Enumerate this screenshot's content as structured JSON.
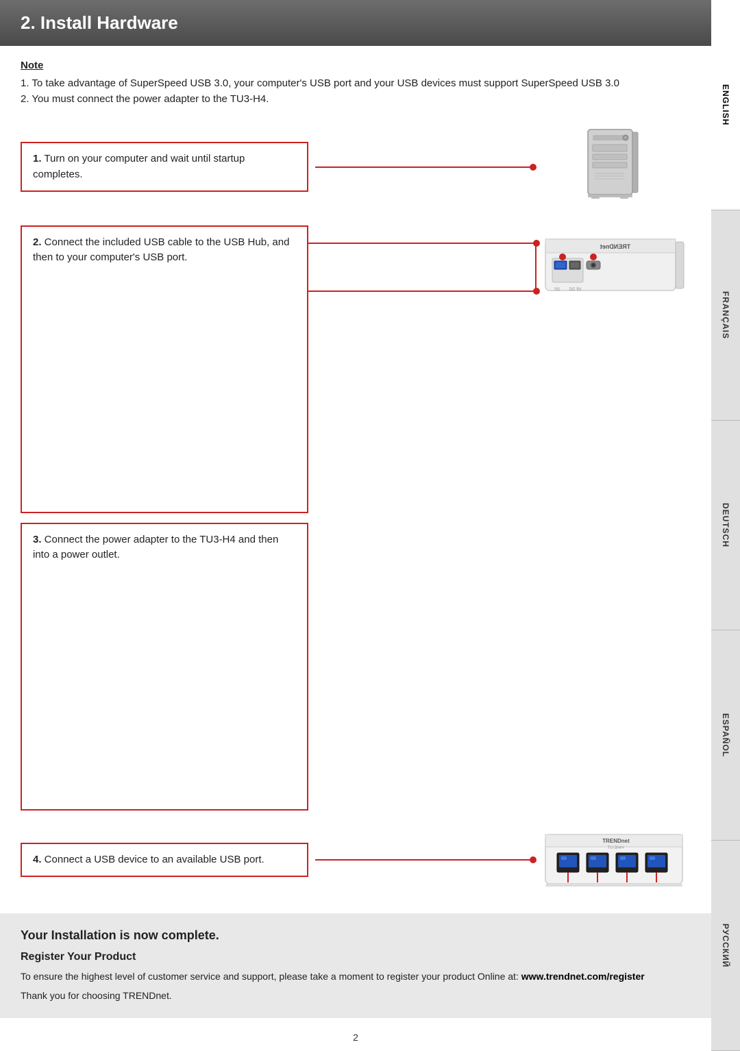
{
  "header": {
    "title": "2. Install Hardware"
  },
  "note": {
    "label": "Note",
    "items": [
      "1. To take advantage of SuperSpeed USB 3.0, your computer's USB port and your USB devices must support SuperSpeed USB 3.0",
      "2.  You must connect the power adapter to the TU3-H4."
    ]
  },
  "steps": [
    {
      "number": "1",
      "text": "Turn on your computer and wait until startup completes."
    },
    {
      "number": "2",
      "text": "Connect the included USB cable to the USB Hub, and then to your computer's USB port."
    },
    {
      "number": "3",
      "text": "Connect the power adapter to the TU3-H4 and then into a power outlet."
    },
    {
      "number": "4",
      "text": "Connect a USB device to an available USB port."
    }
  ],
  "completion": {
    "title": "Your Installation is now complete.",
    "register_title": "Register Your Product",
    "register_text": "To ensure the highest level of customer service and support, please take a moment to register your product Online at: ",
    "register_url": "www.trendnet.com/register",
    "thank_you": "Thank you for choosing TRENDnet."
  },
  "languages": [
    {
      "code": "EN",
      "label": "ENGLISH",
      "active": true
    },
    {
      "code": "FR",
      "label": "FRANÇAIS",
      "active": false
    },
    {
      "code": "DE",
      "label": "DEUTSCH",
      "active": false
    },
    {
      "code": "ES",
      "label": "ESPAÑOL",
      "active": false
    },
    {
      "code": "RU",
      "label": "РУССКИЙ",
      "active": false
    }
  ],
  "page_number": "2"
}
